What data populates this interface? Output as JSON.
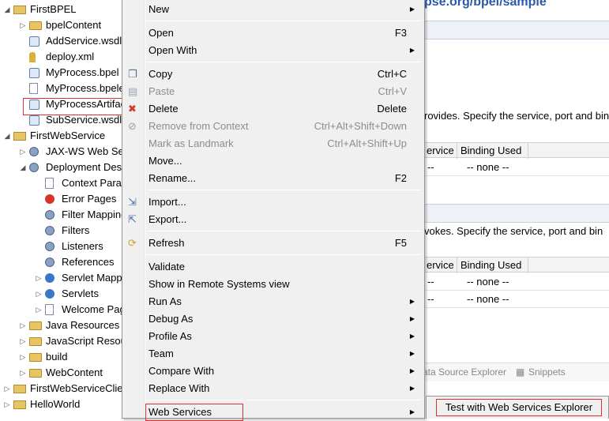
{
  "tree": {
    "items": [
      {
        "label": "FirstBPEL",
        "indent": 0,
        "twisty": "down",
        "icon": "project-icon"
      },
      {
        "label": "bpelContent",
        "indent": 1,
        "twisty": "right",
        "icon": "folder-icon"
      },
      {
        "label": "AddService.wsdl",
        "indent": 1,
        "twisty": "",
        "icon": "wsdl-icon"
      },
      {
        "label": "deploy.xml",
        "indent": 1,
        "twisty": "",
        "icon": "xml-icon"
      },
      {
        "label": "MyProcess.bpel",
        "indent": 1,
        "twisty": "",
        "icon": "bpel-icon"
      },
      {
        "label": "MyProcess.bpelex",
        "indent": 1,
        "twisty": "",
        "icon": "file-icon"
      },
      {
        "label": "MyProcessArtifacts",
        "indent": 1,
        "twisty": "",
        "icon": "wsdl-icon"
      },
      {
        "label": "SubService.wsdl",
        "indent": 1,
        "twisty": "",
        "icon": "wsdl-icon"
      },
      {
        "label": "FirstWebService",
        "indent": 0,
        "twisty": "down",
        "icon": "project-icon"
      },
      {
        "label": "JAX-WS Web Services",
        "indent": 1,
        "twisty": "right",
        "icon": "webservice-icon"
      },
      {
        "label": "Deployment Descriptor",
        "indent": 1,
        "twisty": "down",
        "icon": "descriptor-icon"
      },
      {
        "label": "Context Parameters",
        "indent": 2,
        "twisty": "",
        "icon": "file-icon"
      },
      {
        "label": "Error Pages",
        "indent": 2,
        "twisty": "",
        "icon": "error-icon"
      },
      {
        "label": "Filter Mappings",
        "indent": 2,
        "twisty": "",
        "icon": "filter-icon"
      },
      {
        "label": "Filters",
        "indent": 2,
        "twisty": "",
        "icon": "filter-icon"
      },
      {
        "label": "Listeners",
        "indent": 2,
        "twisty": "",
        "icon": "listener-icon"
      },
      {
        "label": "References",
        "indent": 2,
        "twisty": "",
        "icon": "reference-icon"
      },
      {
        "label": "Servlet Mappings",
        "indent": 2,
        "twisty": "right",
        "icon": "servlet-icon"
      },
      {
        "label": "Servlets",
        "indent": 2,
        "twisty": "right",
        "icon": "servlet-icon"
      },
      {
        "label": "Welcome Pages",
        "indent": 2,
        "twisty": "right",
        "icon": "file-icon"
      },
      {
        "label": "Java Resources",
        "indent": 1,
        "twisty": "right",
        "icon": "java-resources-icon"
      },
      {
        "label": "JavaScript Resources",
        "indent": 1,
        "twisty": "right",
        "icon": "javascript-icon"
      },
      {
        "label": "build",
        "indent": 1,
        "twisty": "right",
        "icon": "folder-icon"
      },
      {
        "label": "WebContent",
        "indent": 1,
        "twisty": "right",
        "icon": "folder-icon"
      },
      {
        "label": "FirstWebServiceClient",
        "indent": 0,
        "twisty": "right",
        "icon": "project-icon"
      },
      {
        "label": "HelloWorld",
        "indent": 0,
        "twisty": "right",
        "icon": "project-icon"
      }
    ]
  },
  "editor": {
    "url": "pse.org/bpel/sample",
    "provides_text": "rovides.  Specify the service, port and bin",
    "invokes_text": "vokes.  Specify the service, port and bin",
    "col_service": "ervice",
    "col_binding": "Binding Used",
    "dash": "--",
    "none": "-- none --",
    "tab_datasource": "ata Source Explorer",
    "tab_snippets": "Snippets"
  },
  "menu": {
    "items": [
      {
        "label": "New",
        "shortcut": "",
        "submenu": true,
        "disabled": false,
        "icon": ""
      },
      {
        "sep": true
      },
      {
        "label": "Open",
        "shortcut": "F3",
        "submenu": false,
        "disabled": false,
        "icon": ""
      },
      {
        "label": "Open With",
        "shortcut": "",
        "submenu": true,
        "disabled": false,
        "icon": ""
      },
      {
        "sep": true
      },
      {
        "label": "Copy",
        "shortcut": "Ctrl+C",
        "submenu": false,
        "disabled": false,
        "icon": "copy-icon"
      },
      {
        "label": "Paste",
        "shortcut": "Ctrl+V",
        "submenu": false,
        "disabled": true,
        "icon": "paste-icon"
      },
      {
        "label": "Delete",
        "shortcut": "Delete",
        "submenu": false,
        "disabled": false,
        "icon": "delete-icon"
      },
      {
        "label": "Remove from Context",
        "shortcut": "Ctrl+Alt+Shift+Down",
        "submenu": false,
        "disabled": true,
        "icon": "remove-context-icon"
      },
      {
        "label": "Mark as Landmark",
        "shortcut": "Ctrl+Alt+Shift+Up",
        "submenu": false,
        "disabled": true,
        "icon": ""
      },
      {
        "label": "Move...",
        "shortcut": "",
        "submenu": false,
        "disabled": false,
        "icon": ""
      },
      {
        "label": "Rename...",
        "shortcut": "F2",
        "submenu": false,
        "disabled": false,
        "icon": ""
      },
      {
        "sep": true
      },
      {
        "label": "Import...",
        "shortcut": "",
        "submenu": false,
        "disabled": false,
        "icon": "import-icon"
      },
      {
        "label": "Export...",
        "shortcut": "",
        "submenu": false,
        "disabled": false,
        "icon": "export-icon"
      },
      {
        "sep": true
      },
      {
        "label": "Refresh",
        "shortcut": "F5",
        "submenu": false,
        "disabled": false,
        "icon": "refresh-icon"
      },
      {
        "sep": true
      },
      {
        "label": "Validate",
        "shortcut": "",
        "submenu": false,
        "disabled": false,
        "icon": ""
      },
      {
        "label": "Show in Remote Systems view",
        "shortcut": "",
        "submenu": false,
        "disabled": false,
        "icon": ""
      },
      {
        "label": "Run As",
        "shortcut": "",
        "submenu": true,
        "disabled": false,
        "icon": ""
      },
      {
        "label": "Debug As",
        "shortcut": "",
        "submenu": true,
        "disabled": false,
        "icon": ""
      },
      {
        "label": "Profile As",
        "shortcut": "",
        "submenu": true,
        "disabled": false,
        "icon": ""
      },
      {
        "label": "Team",
        "shortcut": "",
        "submenu": true,
        "disabled": false,
        "icon": ""
      },
      {
        "label": "Compare With",
        "shortcut": "",
        "submenu": true,
        "disabled": false,
        "icon": ""
      },
      {
        "label": "Replace With",
        "shortcut": "",
        "submenu": true,
        "disabled": false,
        "icon": ""
      },
      {
        "sep": true
      },
      {
        "label": "Web Services",
        "shortcut": "",
        "submenu": true,
        "disabled": false,
        "icon": "",
        "selected": true
      }
    ]
  },
  "submenu": {
    "item": "Test with Web Services Explorer"
  },
  "colors": {
    "highlight_border": "#dd3333",
    "menu_bg": "#f0f0f0",
    "disabled_text": "#8d8d8d",
    "link_blue": "#2a5aa8"
  }
}
